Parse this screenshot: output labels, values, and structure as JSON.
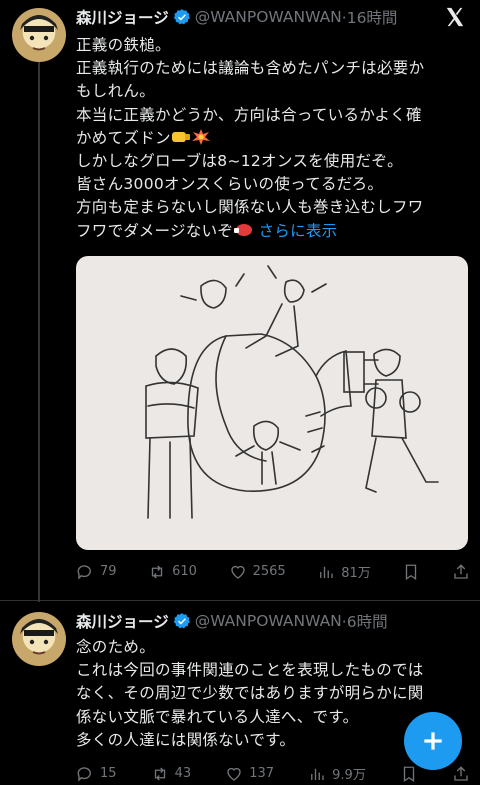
{
  "tweets": [
    {
      "name": "森川ジョージ",
      "handle": "@WANPOWANWAN",
      "time": "·16時間",
      "text_lines": [
        "正義の鉄槌。",
        "正義執行のためには議論も含めたパンチは必要か",
        "もしれん。",
        "本当に正義かどうか、方向は合っているかよく確",
        "かめてズドン",
        "しかしなグローブは8~12オンスを使用だぞ。",
        "皆さん3000オンスくらいの使ってるだろ。",
        "方向も定まらないし関係ない人も巻き込むしフワ",
        "フワでダメージないぞ"
      ],
      "more_label": "さらに表示",
      "stats": {
        "replies": "79",
        "retweets": "610",
        "likes": "2565",
        "views": "81万"
      }
    },
    {
      "name": "森川ジョージ",
      "handle": "@WANPOWANWAN",
      "time": "·6時間",
      "text_lines": [
        "念のため。",
        "これは今回の事件関連のことを表現したものでは",
        "なく、その周辺で少数ではありますが明らかに関",
        "係ない文脈で暴れている人達へ、です。",
        "多くの人達には関係ないです。"
      ],
      "stats": {
        "replies": "15",
        "retweets": "43",
        "likes": "137",
        "views": "9.9万"
      }
    }
  ],
  "colors": {
    "accent": "#1d9bf0",
    "muted": "#71767b",
    "background": "#000000"
  },
  "icons": [
    "x-logo-icon",
    "verified-icon",
    "reply-icon",
    "retweet-icon",
    "like-icon",
    "views-icon",
    "bookmark-icon",
    "share-icon",
    "compose-plus-icon"
  ]
}
